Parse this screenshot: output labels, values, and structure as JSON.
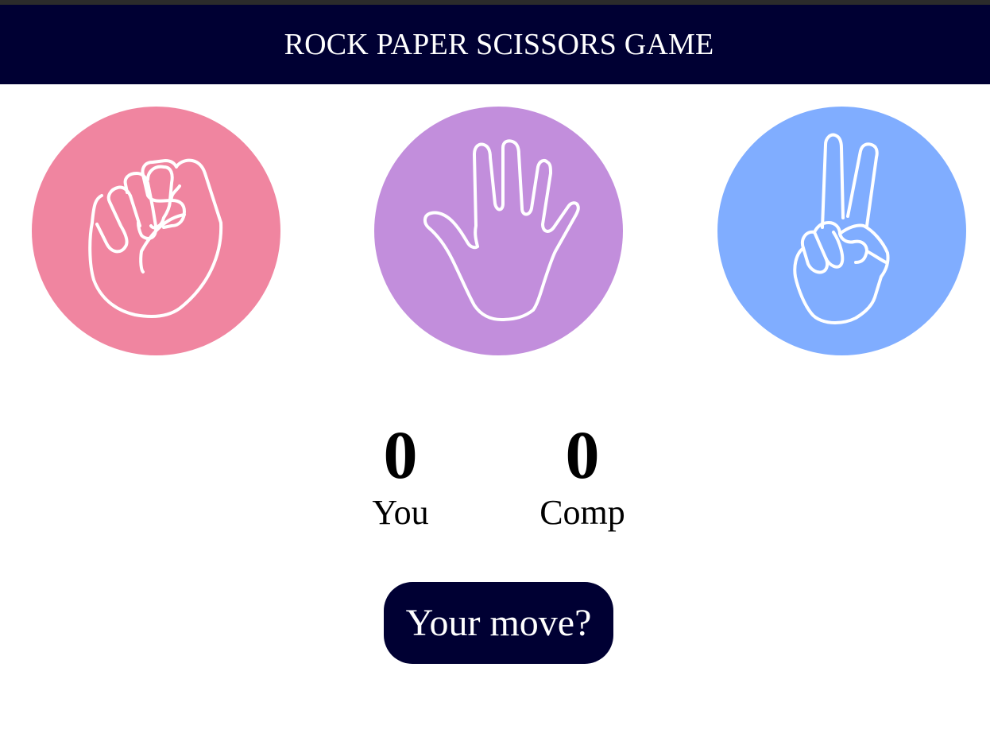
{
  "header": {
    "title": "ROCK PAPER SCISSORS GAME"
  },
  "choices": [
    {
      "id": "rock",
      "icon": "fist-icon",
      "color": "#F085A0"
    },
    {
      "id": "paper",
      "icon": "open-hand-icon",
      "color": "#C28EDC"
    },
    {
      "id": "scissors",
      "icon": "peace-sign-icon",
      "color": "#80ADFF"
    }
  ],
  "scoreboard": {
    "user": {
      "score": "0",
      "label": "You"
    },
    "comp": {
      "score": "0",
      "label": "Comp"
    }
  },
  "message": {
    "text": "Your move?"
  },
  "colors": {
    "header_bg": "#000033",
    "button_bg": "#000033",
    "top_strip": "#2b2b2b"
  }
}
